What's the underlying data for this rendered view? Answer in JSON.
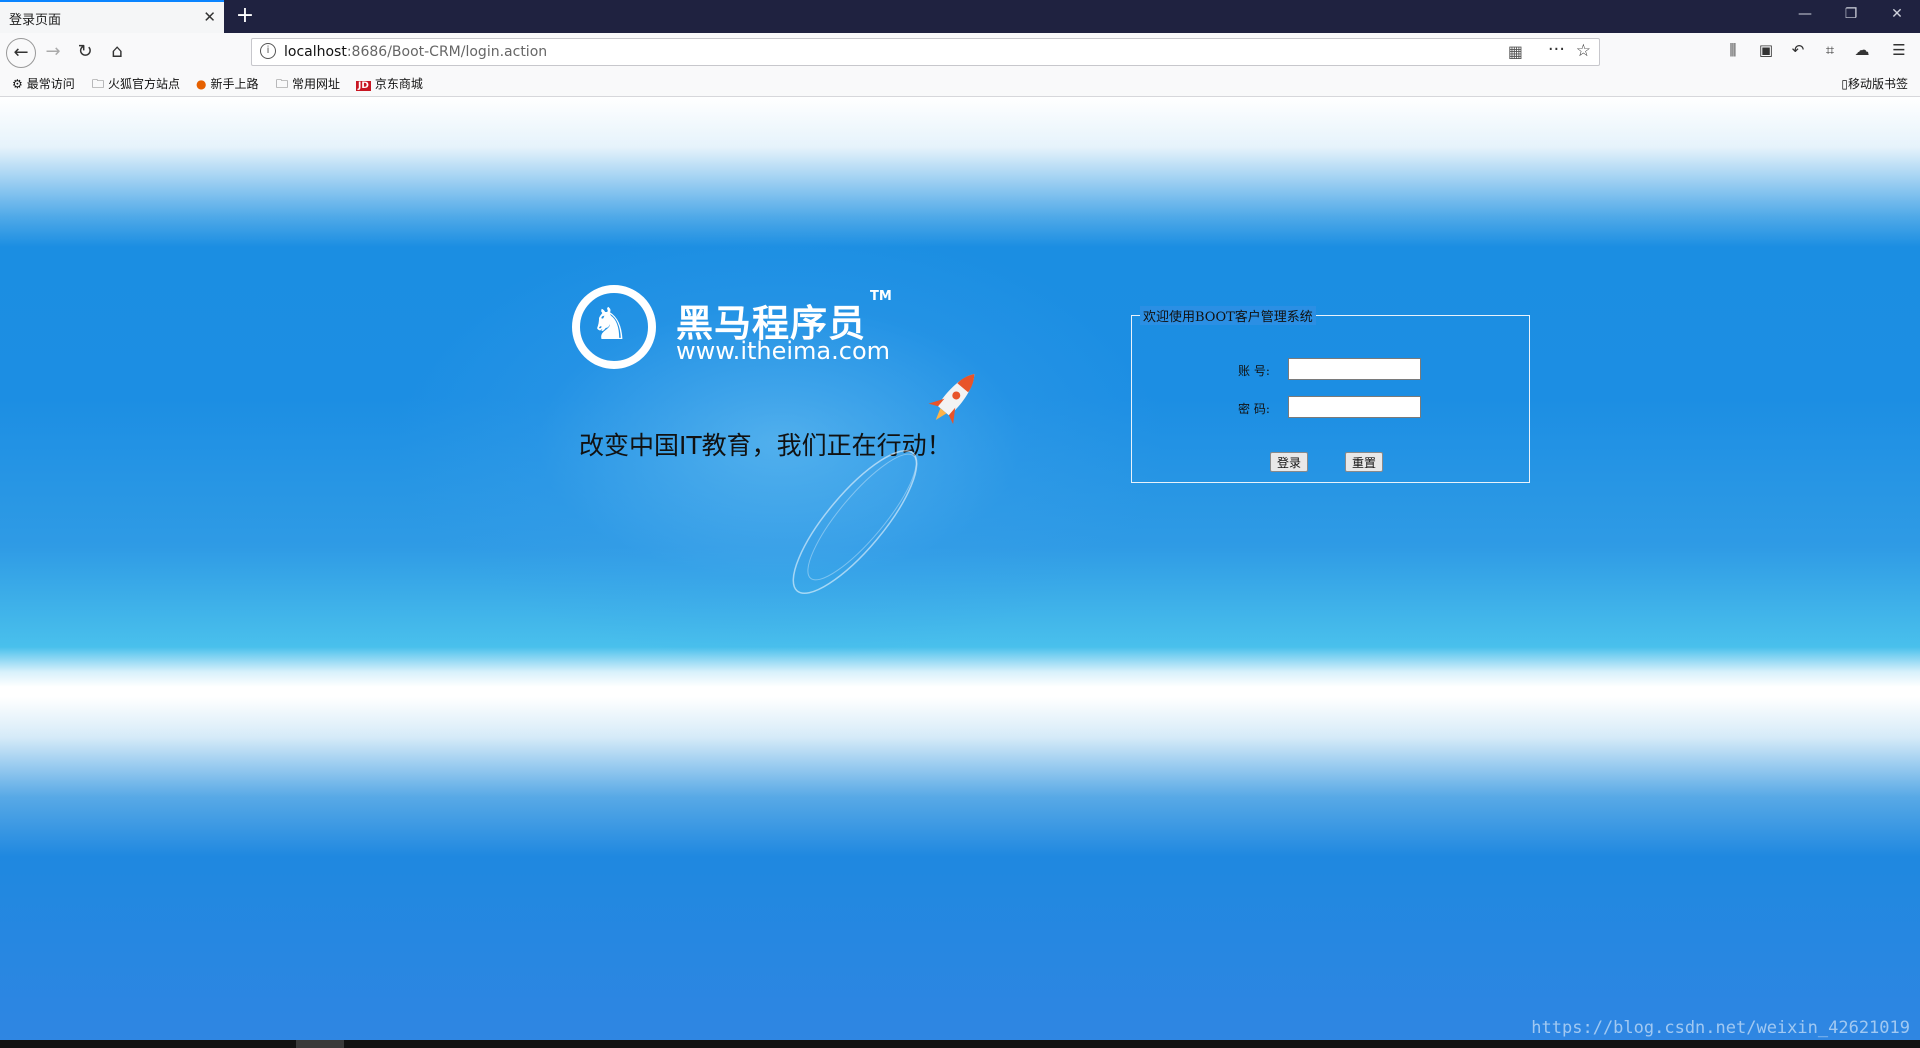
{
  "browser": {
    "tab_title": "登录页面",
    "url_host": "localhost",
    "url_rest": ":8686/Boot-CRM/login.action",
    "bookmarks": [
      {
        "label": "最常访问",
        "icon": "gear-icon"
      },
      {
        "label": "火狐官方站点",
        "icon": "folder-icon"
      },
      {
        "label": "新手上路",
        "icon": "firefox-icon"
      },
      {
        "label": "常用网址",
        "icon": "folder-icon"
      },
      {
        "label": "京东商城",
        "icon": "jd-icon",
        "icon_text": "JD"
      }
    ],
    "mobile_bookmarks": "移动版书签"
  },
  "page": {
    "logo_name": "黑马程序员",
    "logo_tm": "TM",
    "logo_url": "www.itheima.com",
    "slogan": "改变中国IT教育，我们正在行动！"
  },
  "login": {
    "legend": "欢迎使用BOOT客户管理系统",
    "account_label": "账  号:",
    "password_label": "密  码:",
    "account_value": "",
    "password_value": "",
    "login_button": "登录",
    "reset_button": "重置"
  },
  "watermark": "https://blog.csdn.net/weixin_42621019",
  "colors": {
    "titlebar": "#1f2240",
    "accent": "#0a84ff",
    "page_blue": "#1c8ee3"
  }
}
